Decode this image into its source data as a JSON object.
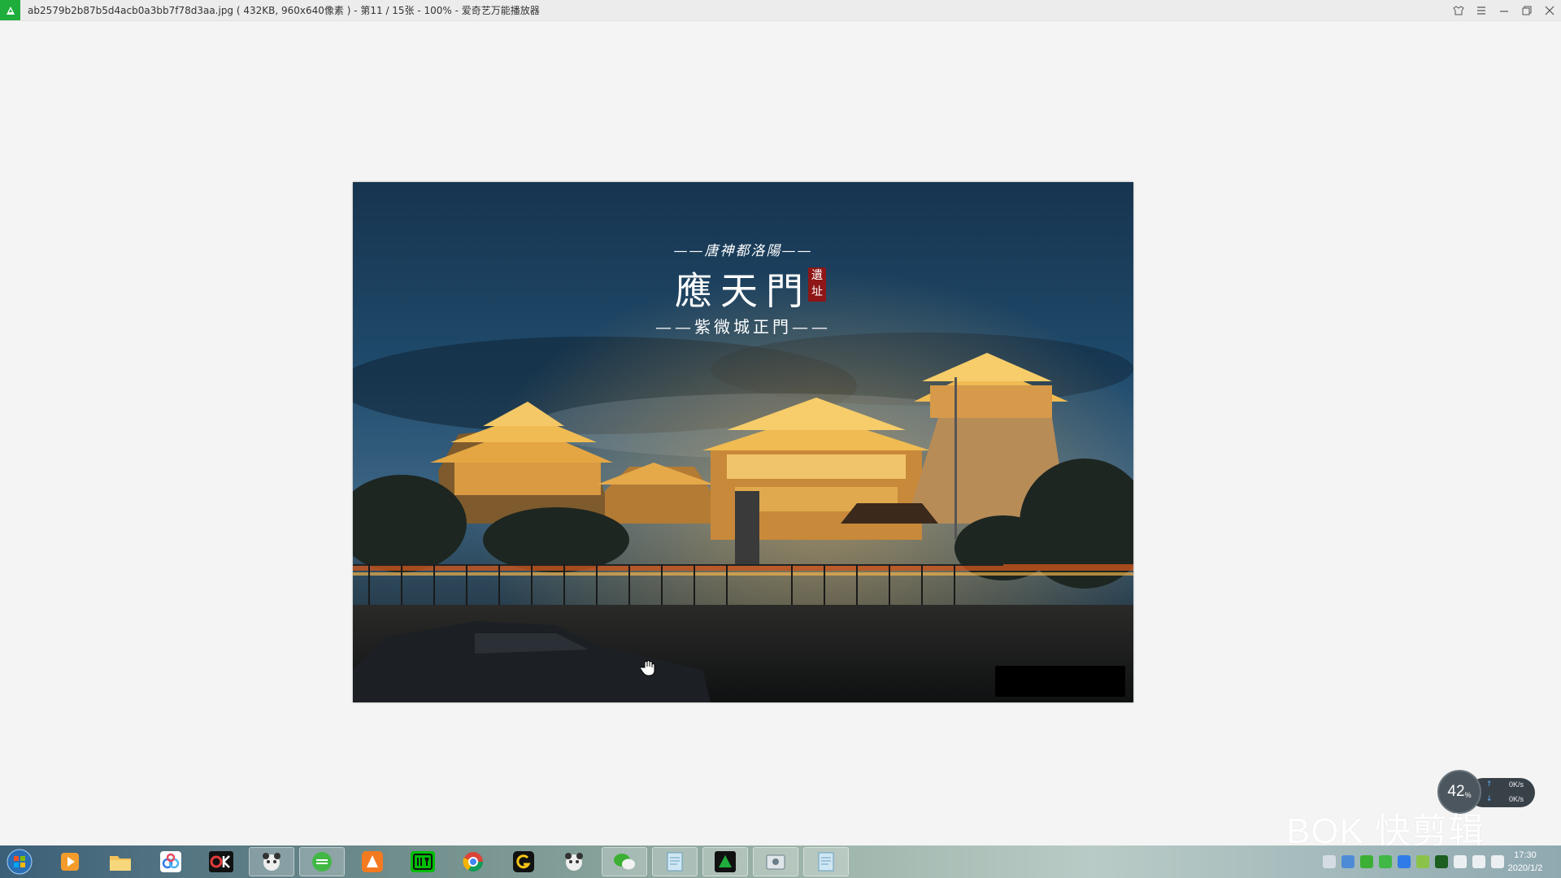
{
  "window": {
    "title": "ab2579b2b87b5d4acb0a3bb7f78d3aa.jpg ( 432KB, 960x640像素 ) - 第11 / 15张 - 100% - 爱奇艺万能播放器",
    "controls": [
      "skin-icon",
      "menu-icon",
      "minimize-icon",
      "restore-icon",
      "close-icon"
    ]
  },
  "photo": {
    "caption_top": "——唐神都洛陽——",
    "caption_main": "應天門",
    "seal_text": "遺址",
    "caption_sub": "——紫微城正門——"
  },
  "netspeed": {
    "percent": "42",
    "percent_unit": "%",
    "upload": "0K/s",
    "download": "0K/s"
  },
  "watermark": {
    "text": "BOK 快剪辑"
  },
  "taskbar": {
    "apps": [
      "start-orb",
      "media-player",
      "file-explorer",
      "baidu-netdisk",
      "ok-recorder",
      "app-panda",
      "iqiyi-green",
      "app-fox",
      "iqiyi",
      "chrome",
      "g-app",
      "app-panda-2",
      "wechat",
      "notepad",
      "iqiyi-player",
      "app-tool",
      "notepad-2"
    ],
    "clock_time": "17:30",
    "clock_date": "2020/1/2"
  }
}
